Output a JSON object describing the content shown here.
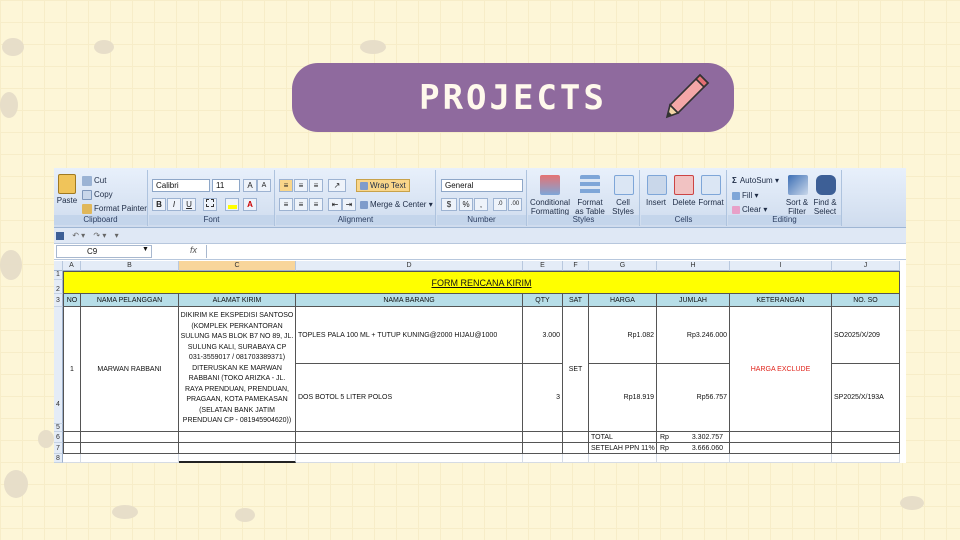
{
  "slide": {
    "title": "PROJECTS"
  },
  "ribbon": {
    "clipboard": {
      "paste": "Paste",
      "cut": "Cut",
      "copy": "Copy",
      "format_painter": "Format Painter",
      "label": "Clipboard"
    },
    "font": {
      "name": "Calibri",
      "size": "11",
      "bold": "B",
      "italic": "I",
      "underline": "U",
      "grow": "A",
      "shrink": "A",
      "label": "Font"
    },
    "alignment": {
      "wrap_text": "Wrap Text",
      "merge_center": "Merge & Center",
      "label": "Alignment"
    },
    "number": {
      "format": "General",
      "percent": "%",
      "comma": ",",
      "label": "Number"
    },
    "styles": {
      "conditional": "Conditional\nFormatting",
      "format_table": "Format\nas Table",
      "cell_styles": "Cell\nStyles",
      "label": "Styles"
    },
    "cells": {
      "insert": "Insert",
      "delete": "Delete",
      "format": "Format",
      "label": "Cells"
    },
    "editing": {
      "autosum": "AutoSum",
      "fill": "Fill",
      "clear": "Clear",
      "sort_filter": "Sort &\nFilter",
      "find_select": "Find &\nSelect",
      "label": "Editing"
    }
  },
  "formula_bar": {
    "name_box": "C9",
    "fx": "fx"
  },
  "columns": [
    "A",
    "B",
    "C",
    "D",
    "E",
    "F",
    "G",
    "H",
    "I",
    "J"
  ],
  "rows": [
    "1",
    "2",
    "3",
    "4",
    "5",
    "6",
    "7",
    "8"
  ],
  "sheet": {
    "form_title": "FORM RENCANA KIRIM",
    "headers": [
      "NO",
      "NAMA PELANGGAN",
      "ALAMAT KIRIM",
      "NAMA BARANG",
      "QTY",
      "SAT",
      "HARGA",
      "JUMLAH",
      "KETERANGAN",
      "NO. SO"
    ],
    "no": "1",
    "customer": "MARWAN RABBANI",
    "address": "DIKIRIM KE EKSPEDISI SANTOSO (KOMPLEK PERKANTORAN SULUNG MAS BLOK B7 NO 89, JL. SULUNG KALI, SURABAYA CP 031-3559017 / 081703389371) DITERUSKAN KE MARWAN RABBANI (TOKO ARIZKA - JL. RAYA PRENDUAN, PRENDUAN, PRAGAAN, KOTA PAMEKASAN (SELATAN BANK JATIM PRENDUAN CP - 081945904620))",
    "items": [
      {
        "name": "TOPLES PALA 100 ML + TUTUP KUNING@2000 HIJAU@1000",
        "qty": "3.000",
        "harga": "Rp1.082",
        "jumlah": "Rp3.246.000",
        "so": "SO2025/X/209"
      },
      {
        "name": "DOS BOTOL 5 LITER POLOS",
        "qty": "3",
        "harga": "Rp18.919",
        "jumlah": "Rp56.757",
        "so": "SP2025/X/193A"
      }
    ],
    "sat": "SET",
    "keterangan": "HARGA EXCLUDE",
    "total_label": "TOTAL",
    "total_cur": "Rp",
    "total_value": "3.302.757",
    "ppn_label": "SETELAH PPN 11%",
    "ppn_cur": "Rp",
    "ppn_value": "3.666.060"
  },
  "colors": {
    "title_fill": "#ffff00",
    "header_fill": "#b7dee8",
    "keterangan_text": "#e0241b",
    "pill": "#8f6a9e"
  }
}
